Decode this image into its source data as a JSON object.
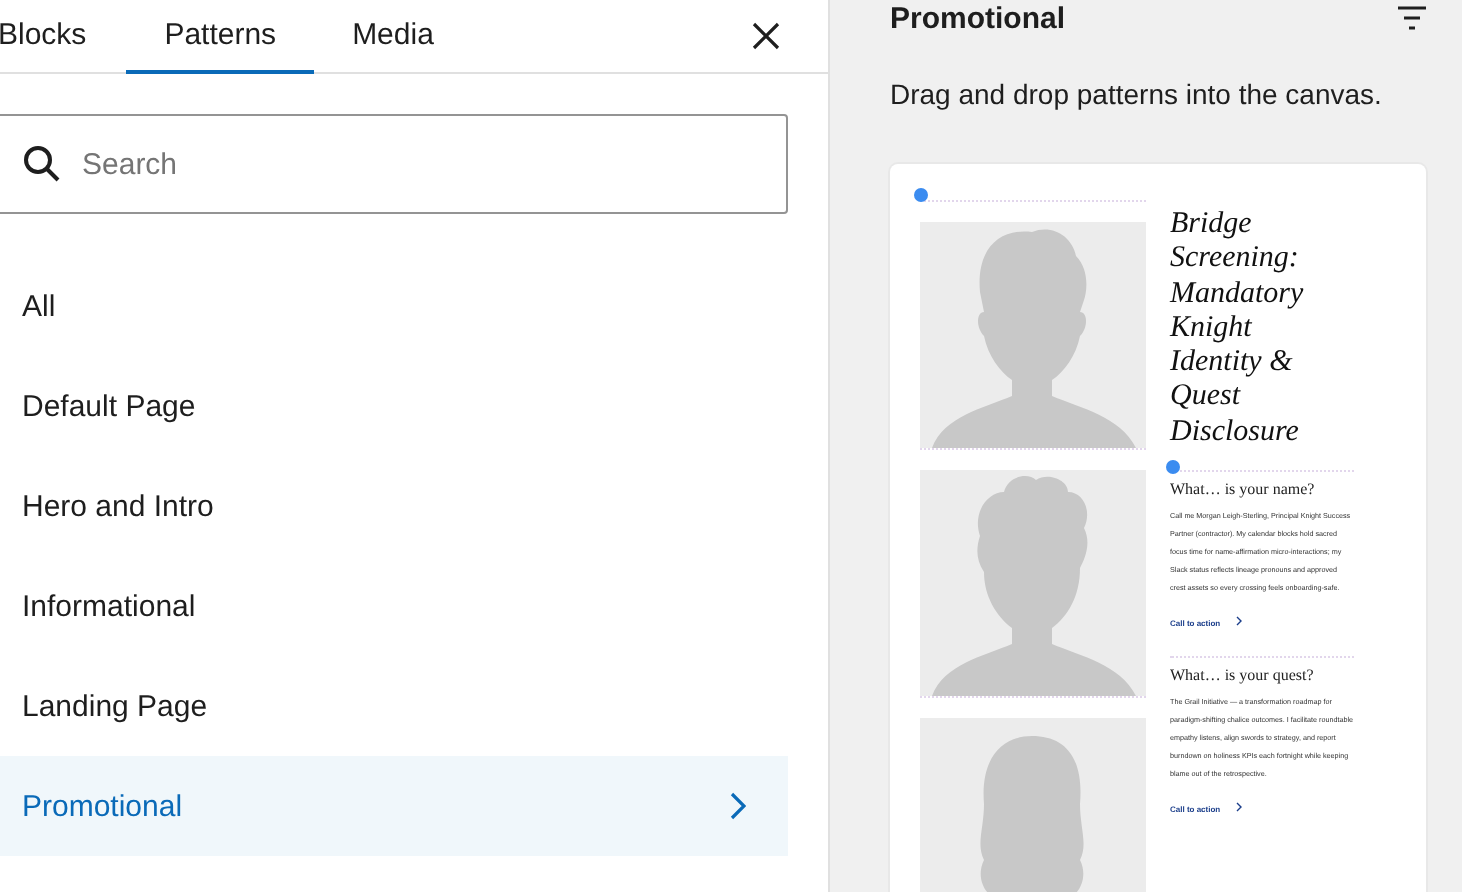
{
  "tabs": [
    {
      "label": "Blocks",
      "selected": false
    },
    {
      "label": "Patterns",
      "selected": true
    },
    {
      "label": "Media",
      "selected": false
    }
  ],
  "search": {
    "placeholder": "Search"
  },
  "categories": [
    {
      "label": "All",
      "selected": false
    },
    {
      "label": "Default Page",
      "selected": false
    },
    {
      "label": "Hero and Intro",
      "selected": false
    },
    {
      "label": "Informational",
      "selected": false
    },
    {
      "label": "Landing Page",
      "selected": false
    },
    {
      "label": "Promotional",
      "selected": true
    }
  ],
  "panel": {
    "title": "Promotional",
    "description": "Drag and drop patterns into the canvas."
  },
  "preview": {
    "title": "Bridge Screening: Mandatory Knight Identity & Quest Disclosure",
    "images": [
      {
        "kind": "short-hair"
      },
      {
        "kind": "curly-hair"
      },
      {
        "kind": "long-hair"
      }
    ],
    "sections": [
      {
        "heading": "What… is your name?",
        "body": "Call me Morgan Leigh-Sterling, Principal Knight Success Partner (contractor). My calendar blocks hold sacred focus time for name-affirmation micro-interactions; my Slack status reflects lineage pronouns and approved crest assets so every crossing feels onboarding-safe.",
        "link": "Call to action"
      },
      {
        "heading": "What… is your quest?",
        "body": "The Grail Initiative — a transformation roadmap for paradigm-shifting chalice outcomes. I facilitate roundtable empathy listens, align swords to strategy, and report burndown on holiness KPIs each fortnight while keeping blame out of the retrospective.",
        "link": "Call to action"
      }
    ]
  }
}
